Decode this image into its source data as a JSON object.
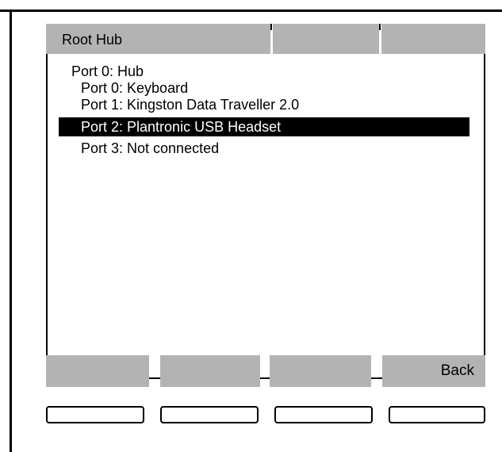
{
  "header": {
    "title": "Root Hub"
  },
  "ports": [
    {
      "label": "Port 0: Hub",
      "level": 0,
      "selected": false
    },
    {
      "label": "Port 0: Keyboard",
      "level": 1,
      "selected": false
    },
    {
      "label": "Port 1: Kingston Data Traveller 2.0",
      "level": 1,
      "selected": false
    },
    {
      "label": "Port 2: Plantronic USB Headset",
      "level": 1,
      "selected": true
    },
    {
      "label": "Port 3: Not connected",
      "level": 1,
      "selected": false
    }
  ],
  "softkeys": {
    "key1": "",
    "key2": "",
    "key3": "",
    "key4": "Back"
  },
  "colors": {
    "bar_gray": "#b3b3b3",
    "selection": "#000000",
    "selection_text": "#ffffff"
  }
}
